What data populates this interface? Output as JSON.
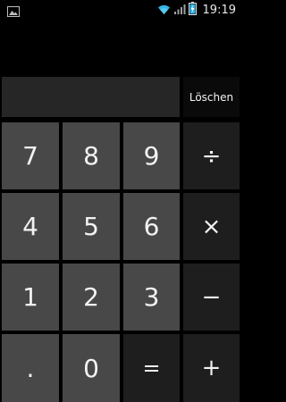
{
  "status_bar": {
    "time": "19:19",
    "icons": [
      "gallery-notification-icon",
      "wifi-icon",
      "signal-icon",
      "battery-charging-icon"
    ]
  },
  "display": {
    "value": ""
  },
  "clear_button": {
    "label": "Löschen"
  },
  "keypad": {
    "rows": [
      [
        "7",
        "8",
        "9",
        "÷"
      ],
      [
        "4",
        "5",
        "6",
        "×"
      ],
      [
        "1",
        "2",
        "3",
        "−"
      ],
      [
        ".",
        "0",
        "=",
        "+"
      ]
    ]
  },
  "colors": {
    "background": "#000000",
    "number_key": "#484848",
    "operator_key": "#1e1e1e",
    "display": "#262626",
    "text": "#f2f2f2",
    "accent": "#33b5e5"
  }
}
